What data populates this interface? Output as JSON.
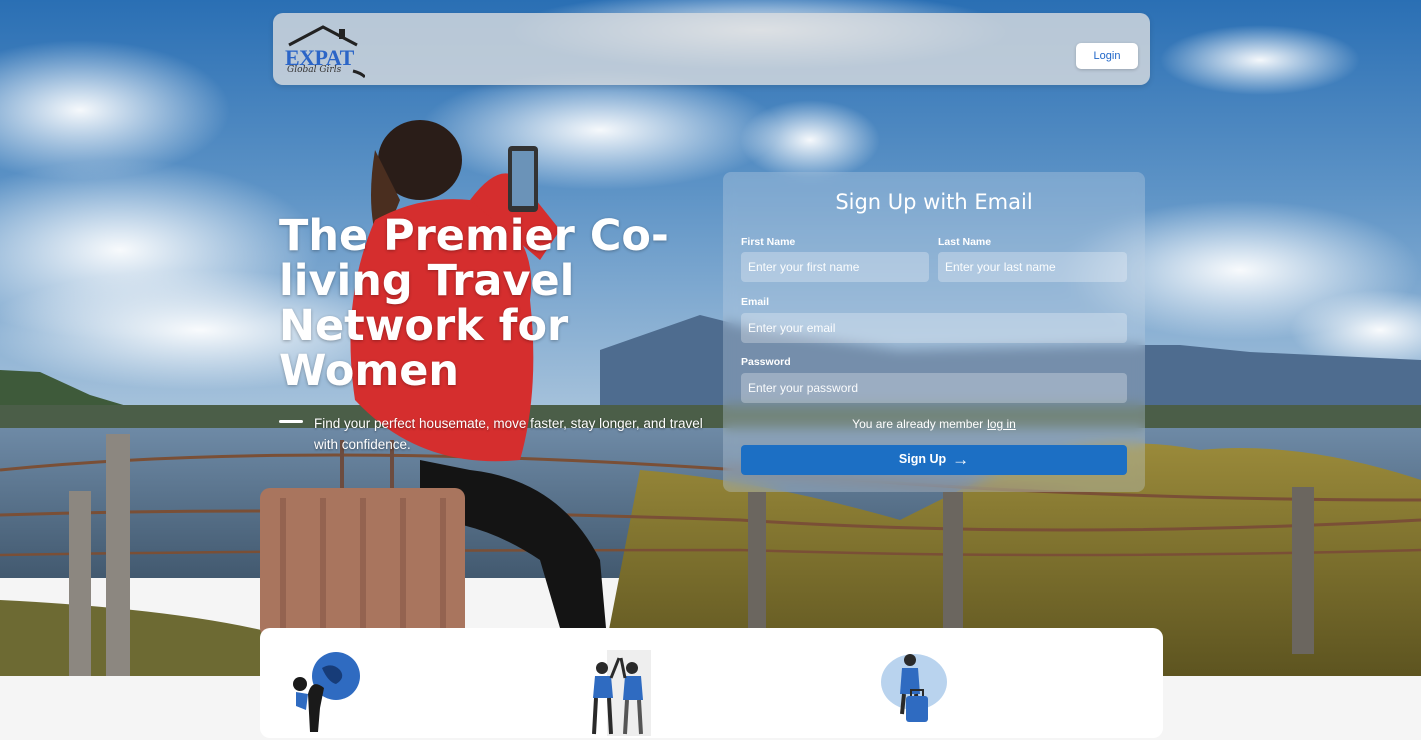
{
  "navbar": {
    "logo_text": "EXPAT",
    "logo_sub": "Global Girls",
    "login_label": "Login"
  },
  "hero": {
    "headline": "The Premier Co-living Travel Network for Women",
    "tagline": "Find your perfect housemate, move faster, stay longer, and travel with confidence."
  },
  "signup": {
    "title": "Sign Up with Email",
    "first_name_label": "First Name",
    "first_name_placeholder": "Enter your first name",
    "last_name_label": "Last Name",
    "last_name_placeholder": "Enter your last name",
    "email_label": "Email",
    "email_placeholder": "Enter your email",
    "password_label": "Password",
    "password_placeholder": "Enter your password",
    "member_text": "You are already member",
    "login_link": "log in",
    "button_label": "Sign Up"
  },
  "features": {
    "icons": [
      "globe-traveler-illustration",
      "high-five-illustration",
      "suitcase-traveler-illustration"
    ]
  },
  "colors": {
    "accent": "#1c6fc4",
    "logo_blue": "#2b65c7"
  }
}
